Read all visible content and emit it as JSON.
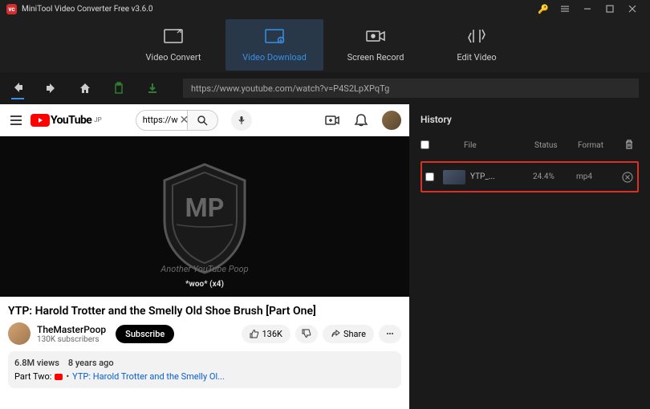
{
  "app": {
    "title": "MiniTool Video Converter Free v3.6.0"
  },
  "tabs": [
    {
      "id": "convert",
      "label": "Video Convert"
    },
    {
      "id": "download",
      "label": "Video Download"
    },
    {
      "id": "record",
      "label": "Screen Record"
    },
    {
      "id": "edit",
      "label": "Edit Video"
    }
  ],
  "active_tab": "download",
  "url": "https://www.youtube.com/watch?v=P4S2LpXPqTg",
  "youtube": {
    "brand": "YouTube",
    "region": "JP",
    "search_placeholder": "https://w",
    "watermark": "Another YouTube Poop",
    "overlay_caption": "*woo* (x4)",
    "video_title": "YTP: Harold Trotter and the Smelly Old Shoe Brush [Part One]",
    "channel_name": "TheMasterPoop",
    "subscriber_count": "130K subscribers",
    "subscribe_label": "Subscribe",
    "likes_label": "136K",
    "share_label": "Share",
    "views_line": "6.8M views",
    "age_line": "8 years ago",
    "desc_prefix": "Part Two:",
    "desc_link": "YTP: Harold Trotter and the Smelly Ol..."
  },
  "history": {
    "title": "History",
    "columns": {
      "file": "File",
      "status": "Status",
      "format": "Format"
    },
    "items": [
      {
        "name": "YTP_...",
        "status": "24.4%",
        "format": "mp4"
      }
    ]
  }
}
